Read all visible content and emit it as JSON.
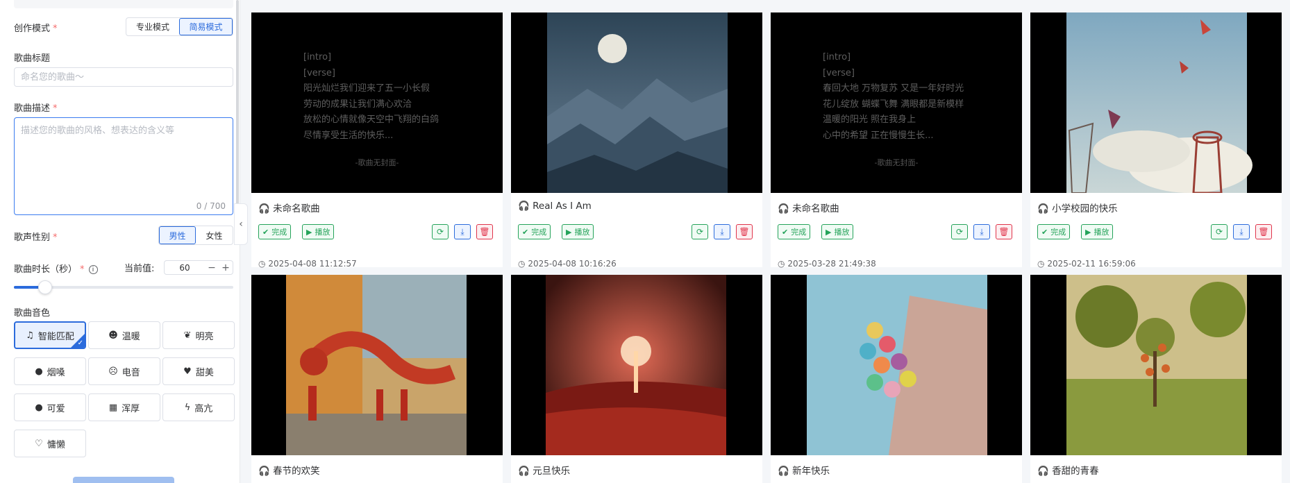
{
  "sidebar": {
    "mode_label": "创作模式",
    "mode_options": [
      "专业模式",
      "简易模式"
    ],
    "title_label": "歌曲标题",
    "title_placeholder": "命名您的歌曲～",
    "desc_label": "歌曲描述",
    "desc_placeholder": "描述您的歌曲的风格、想表达的含义等",
    "desc_counter": "0 / 700",
    "gender_label": "歌声性别",
    "gender_options": [
      "男性",
      "女性"
    ],
    "duration_label": "歌曲时长（秒）",
    "current_label": "当前值:",
    "duration_value": "60",
    "duration_min": 30,
    "duration_max": 240,
    "timbre_label": "歌曲音色",
    "timbres": [
      {
        "label": "智能匹配",
        "icon": "music-note-icon",
        "glyph": "♫",
        "selected": true
      },
      {
        "label": "温暖",
        "icon": "smile-icon",
        "glyph": "☻",
        "selected": false
      },
      {
        "label": "明亮",
        "icon": "leaf-icon",
        "glyph": "❦",
        "selected": false
      },
      {
        "label": "烟嗓",
        "icon": "lightbulb-icon",
        "glyph": "●",
        "selected": false
      },
      {
        "label": "电音",
        "icon": "dizzy-face-icon",
        "glyph": "☹",
        "selected": false
      },
      {
        "label": "甜美",
        "icon": "heart-icon",
        "glyph": "♥",
        "selected": false
      },
      {
        "label": "可爱",
        "icon": "user-icon",
        "glyph": "●",
        "selected": false
      },
      {
        "label": "浑厚",
        "icon": "keyboard-icon",
        "glyph": "▦",
        "selected": false
      },
      {
        "label": "高亢",
        "icon": "bolt-icon",
        "glyph": "ϟ",
        "selected": false
      },
      {
        "label": "慵懒",
        "icon": "heartbeat-icon",
        "glyph": "♡",
        "selected": false
      }
    ]
  },
  "card_labels": {
    "done": "完成",
    "play": "播放",
    "no_cover": "-歌曲无封面-"
  },
  "songs": [
    {
      "name": "未命名歌曲",
      "date": "2025-04-08 11:12:57",
      "lyrics": "[intro]\n[verse]\n阳光灿烂我们迎来了五一小长假\n劳动的成果让我们满心欢洽\n放松的心情就像天空中飞翔的白鸽\n尽情享受生活的快乐..."
    },
    {
      "name": "Real As I Am",
      "date": "2025-04-08 10:16:26"
    },
    {
      "name": "未命名歌曲",
      "date": "2025-03-28 21:49:38",
      "lyrics": "[intro]\n[verse]\n春回大地 万物复苏 又是一年好时光\n花儿绽放 蝴蝶飞舞 满眼都是新模样\n温暖的阳光 照在我身上\n心中的希望 正在慢慢生长..."
    },
    {
      "name": "小学校园的快乐",
      "date": "2025-02-11 16:59:06"
    },
    {
      "name": "春节的欢笑"
    },
    {
      "name": "元旦快乐"
    },
    {
      "name": "新年快乐"
    },
    {
      "name": "香甜的青春"
    }
  ],
  "colors": {
    "accent": "#2b6bdc",
    "success": "#25a35a",
    "danger": "#e0344b"
  }
}
